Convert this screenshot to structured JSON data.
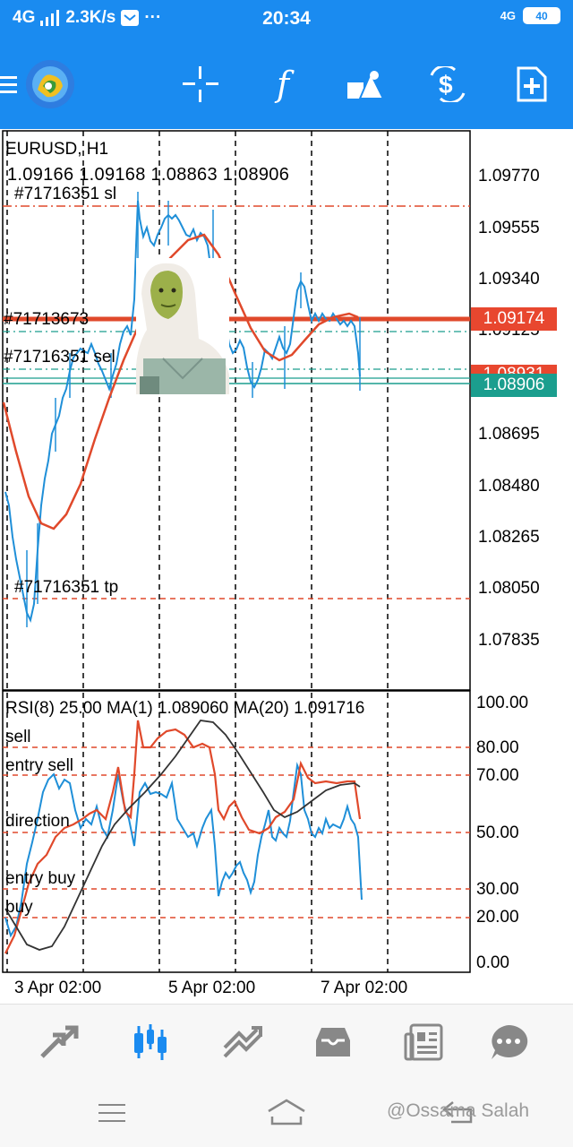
{
  "status_bar": {
    "network": "4G",
    "speed": "2.3K/s",
    "time": "20:34",
    "network_right": "4G",
    "battery": "40"
  },
  "toolbar": {
    "icons": [
      "menu-icon",
      "app-logo",
      "crosshair-icon",
      "indicators-icon",
      "objects-icon",
      "trade-icon",
      "new-order-icon"
    ],
    "indicators_label": "f"
  },
  "chart": {
    "symbol": "EURUSD, H1",
    "ohlc": "1.09166 1.09168 1.08863 1.08906",
    "order_labels": {
      "sl_top": "#71716351 sl",
      "mid1": "#71713673",
      "sl_mid": "#71716351 sel",
      "tp": "#71716351 tp"
    },
    "price_ticks": [
      "1.09770",
      "1.09555",
      "1.09340",
      "1.09125",
      "1.08695",
      "1.08480",
      "1.08265",
      "1.08050",
      "1.07835"
    ],
    "price_tags": {
      "red": "1.09174",
      "teal": "1.08906",
      "hidden": "1.08931"
    },
    "colors": {
      "red_tag": "#e8472f",
      "teal_tag": "#1b9e8e",
      "candle": "#1f8fd8",
      "ma": "#e0492b"
    }
  },
  "rsi": {
    "header": "RSI(8) 25.00 MA(1) 1.089060 MA(20) 1.091716",
    "labels": {
      "sell": "sell",
      "entry_sell": "entry sell",
      "direction": "direction",
      "entry_buy": "entry buy",
      "buy": "buy"
    },
    "ticks": [
      "100.00",
      "80.00",
      "70.00",
      "50.00",
      "30.00",
      "20.00",
      "0.00"
    ]
  },
  "time_axis": [
    "3 Apr 02:00",
    "5 Apr 02:00",
    "7 Apr 02:00"
  ],
  "bottom_nav": {
    "items": [
      "quotes-icon",
      "chart-icon",
      "trade-icon",
      "history-icon",
      "news-icon",
      "chat-icon"
    ],
    "active": "chart-icon"
  },
  "watermark": "@Ossama Salah"
}
